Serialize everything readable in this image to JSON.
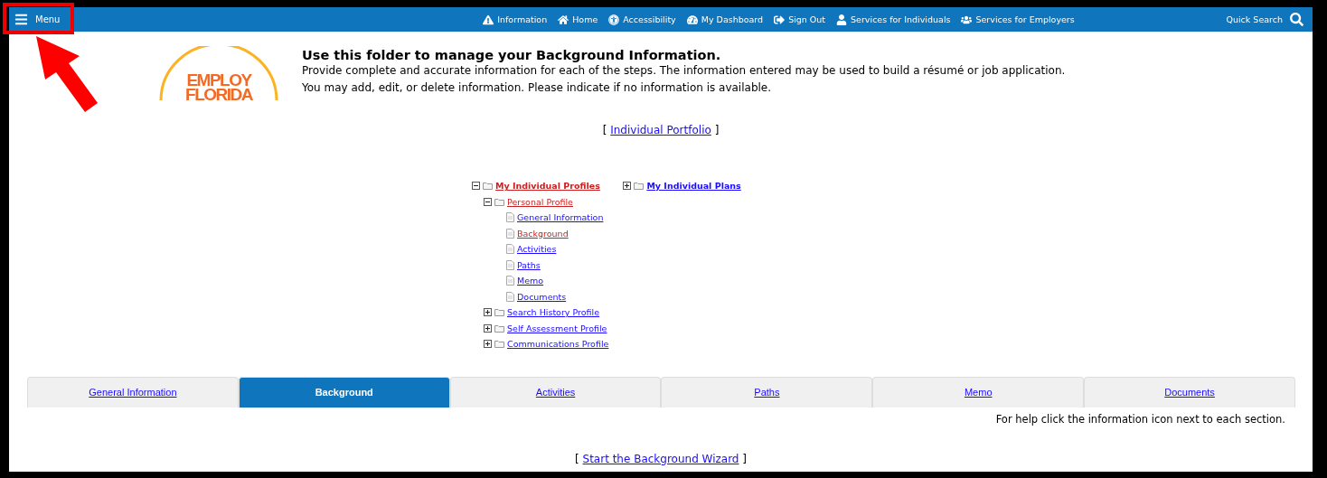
{
  "menu_button": {
    "label": "Menu"
  },
  "nav": [
    {
      "label": "Information"
    },
    {
      "label": "Home"
    },
    {
      "label": "Accessibility"
    },
    {
      "label": "My Dashboard"
    },
    {
      "label": "Sign Out"
    },
    {
      "label": "Services for Individuals"
    },
    {
      "label": "Services for Employers"
    }
  ],
  "quick_search": {
    "label": "Quick Search"
  },
  "logo": {
    "lines": [
      "EMPLOY",
      "FLORIDA"
    ]
  },
  "intro": {
    "title": "Use this folder to manage your Background Information.",
    "text": "Provide complete and accurate information for each of the steps. The information entered may be used to build a résumé or job application. You may add, edit, or delete information. Please indicate if no information is available."
  },
  "portfolio_link": {
    "open": "[",
    "label": "Individual Portfolio",
    "close": "]"
  },
  "tree": [
    {
      "label": "My Individual Profiles",
      "kind": "folder",
      "expanded": true,
      "active": true,
      "children": [
        {
          "label": "Personal Profile",
          "kind": "folder",
          "expanded": true,
          "active": true,
          "children": [
            {
              "label": "General Information",
              "kind": "page",
              "active": false
            },
            {
              "label": "Background",
              "kind": "page",
              "active": true
            },
            {
              "label": "Activities",
              "kind": "page",
              "active": false
            },
            {
              "label": "Paths",
              "kind": "page",
              "active": false
            },
            {
              "label": "Memo",
              "kind": "page",
              "active": false
            },
            {
              "label": "Documents",
              "kind": "page",
              "active": false
            }
          ]
        },
        {
          "label": "Search History Profile",
          "kind": "folder",
          "expanded": false,
          "active": false
        },
        {
          "label": "Self Assessment Profile",
          "kind": "folder",
          "expanded": false,
          "active": false
        },
        {
          "label": "Communications Profile",
          "kind": "folder",
          "expanded": false,
          "active": false
        }
      ]
    },
    {
      "label": "My Individual Plans",
      "kind": "folder",
      "expanded": false,
      "active": false
    }
  ],
  "tabs": [
    {
      "label": "General Information",
      "selected": false
    },
    {
      "label": "Background",
      "selected": true
    },
    {
      "label": "Activities",
      "selected": false
    },
    {
      "label": "Paths",
      "selected": false
    },
    {
      "label": "Memo",
      "selected": false
    },
    {
      "label": "Documents",
      "selected": false
    }
  ],
  "help_text": "For help click the information icon next to each section.",
  "wizard_link": {
    "open": "[",
    "label": "Start the Background Wizard",
    "close": "]"
  }
}
